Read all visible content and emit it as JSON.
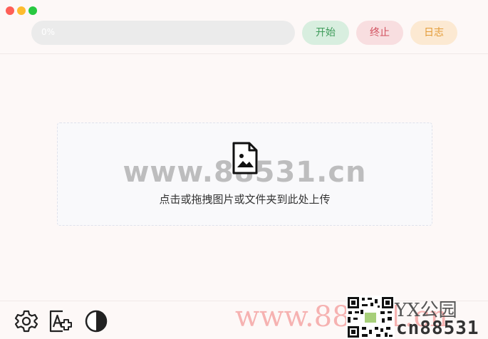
{
  "toolbar": {
    "progress": {
      "value": 0,
      "label": "0%"
    },
    "start_label": "开始",
    "stop_label": "终止",
    "log_label": "日志"
  },
  "dropzone": {
    "icon": "image-file-icon",
    "text": "点击或拖拽图片或文件夹到此处上传"
  },
  "bottom_bar": {
    "icons": [
      "gear-icon",
      "font-size-icon",
      "contrast-icon"
    ]
  },
  "watermarks": {
    "center": "www.88531.cn",
    "bottom_url": "www.88531.cn",
    "brand_top": "YX公园",
    "brand_bottom": "cn88531"
  },
  "colors": {
    "start": "#3e9b5a",
    "stop": "#d2515f",
    "log": "#e39b36"
  }
}
